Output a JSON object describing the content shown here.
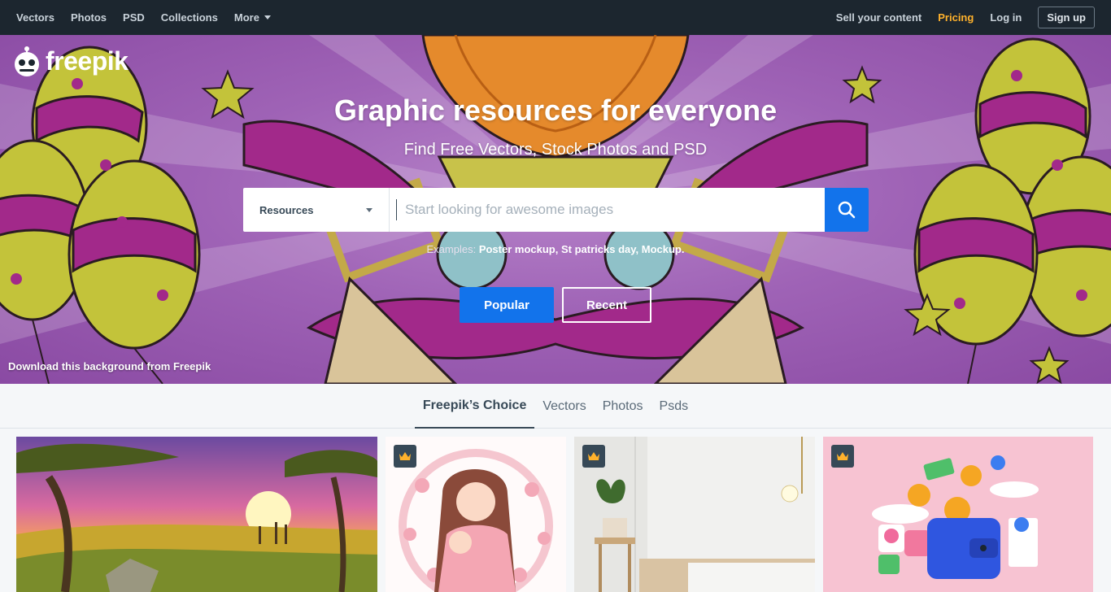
{
  "nav": {
    "left": [
      {
        "label": "Vectors"
      },
      {
        "label": "Photos"
      },
      {
        "label": "PSD"
      },
      {
        "label": "Collections"
      },
      {
        "label": "More"
      }
    ],
    "sell": "Sell your content",
    "pricing": "Pricing",
    "login": "Log in",
    "signup": "Sign up"
  },
  "logo": {
    "text": "freepik"
  },
  "hero": {
    "title": "Graphic resources for everyone",
    "subtitle": "Find Free Vectors, Stock Photos and PSD",
    "select_value": "Resources",
    "search_placeholder": "Start looking for awesome images",
    "examples_label": "Examples:",
    "examples": [
      "Poster mockup",
      "St patricks day",
      "Mockup"
    ],
    "popular_label": "Popular",
    "recent_label": "Recent",
    "credit": "Download this background from Freepik"
  },
  "tabs": [
    {
      "label": "Freepik’s Choice",
      "active": true
    },
    {
      "label": "Vectors"
    },
    {
      "label": "Photos"
    },
    {
      "label": "Psds"
    }
  ],
  "gallery": [
    {
      "name": "savanna-sunset-illustration",
      "premium": false
    },
    {
      "name": "mother-and-baby-watercolor",
      "premium": true
    },
    {
      "name": "interior-plant-room",
      "premium": true
    },
    {
      "name": "3d-wallet-crypto-coins",
      "premium": true
    }
  ],
  "colors": {
    "topbar": "#1c262f",
    "accent": "#1273eb",
    "pricing": "#ffb22c",
    "hero_purple": "#9f63b6"
  }
}
